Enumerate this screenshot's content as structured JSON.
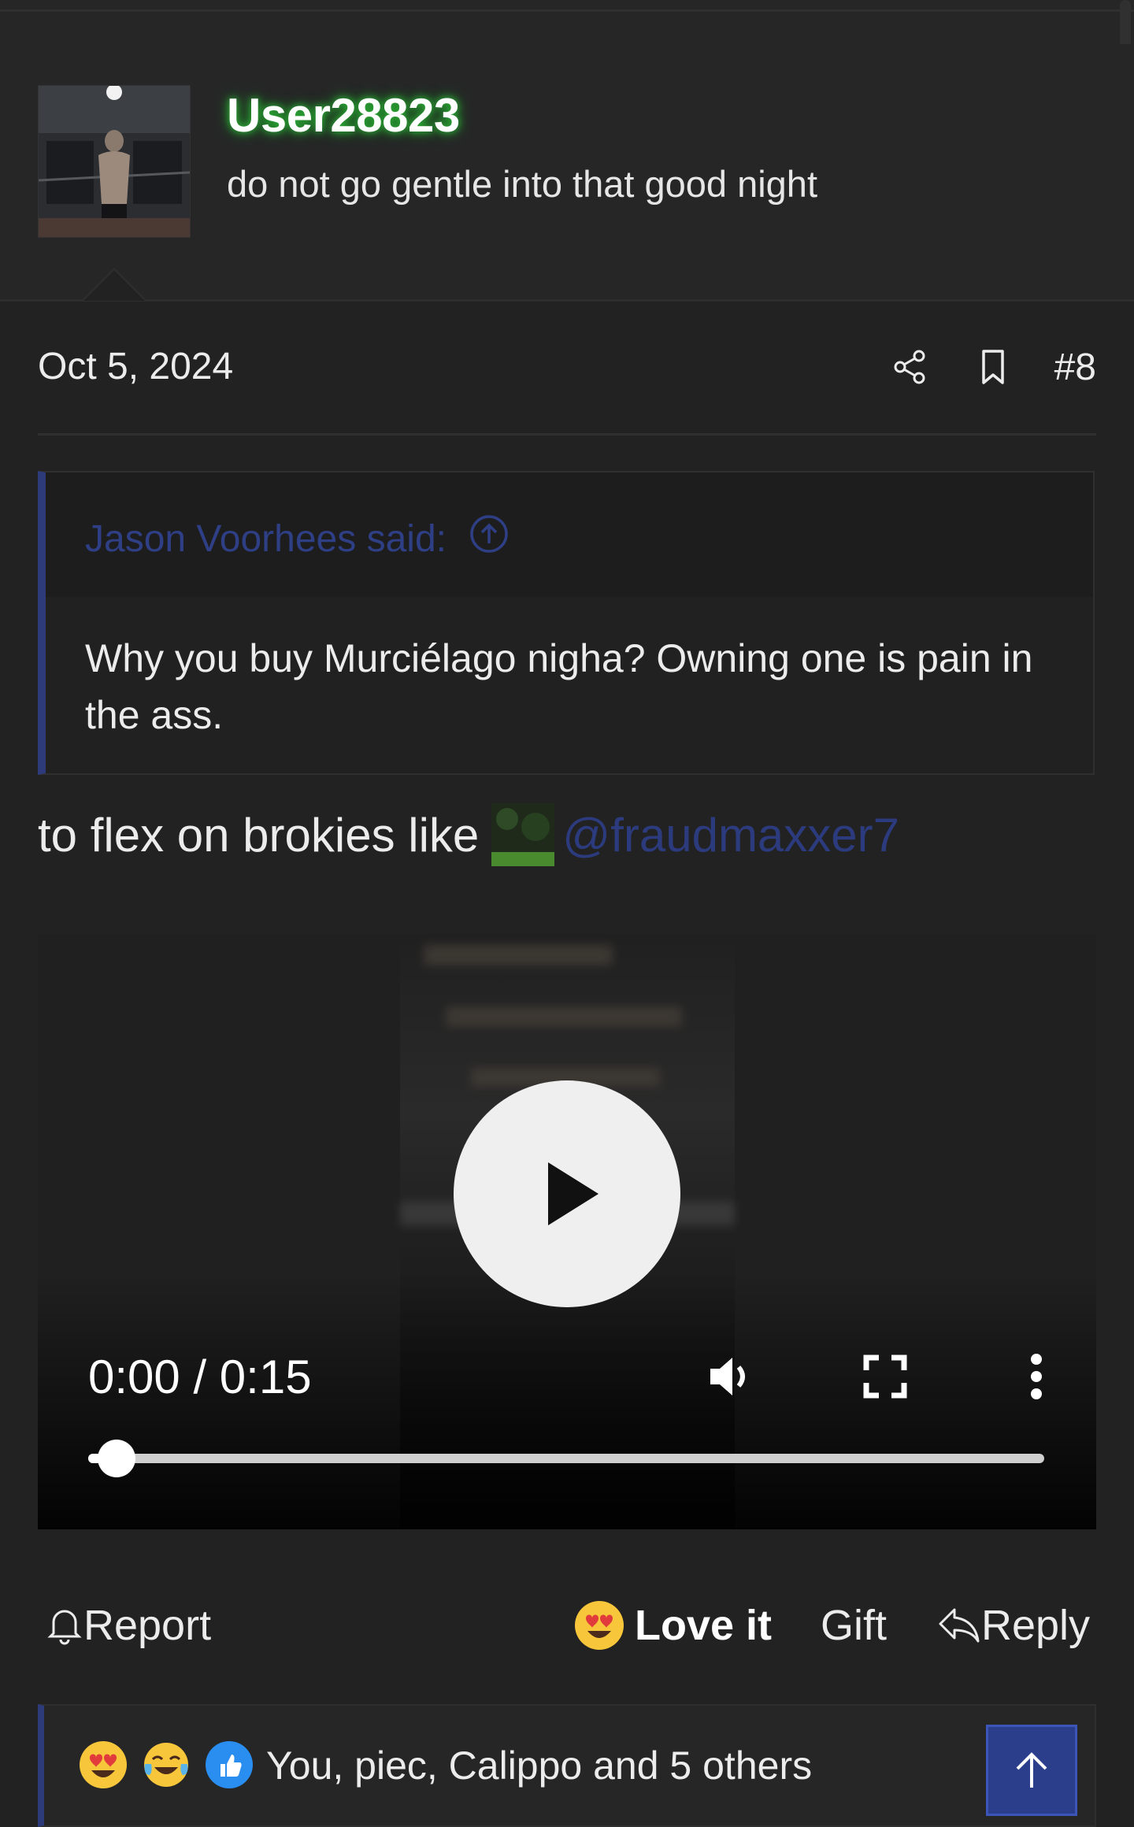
{
  "user": {
    "name": "User28823",
    "title": "do not go gentle into that good night"
  },
  "post": {
    "date": "Oct 5, 2024",
    "number": "#8"
  },
  "quote": {
    "author": "Jason Voorhees said:",
    "body": "Why you buy Murciélago nigha? Owning one is pain in the ass."
  },
  "reply": {
    "text": "to flex on brokies like",
    "mention": "@fraudmaxxer7"
  },
  "video": {
    "time": "0:00 / 0:15",
    "progress_percent": 3
  },
  "actions": {
    "report": "Report",
    "love": "Love it",
    "gift": "Gift",
    "reply": "Reply"
  },
  "reactions": {
    "summary": "You, piec, Calippo and 5 others",
    "icons": [
      "heart-eyes-emoji",
      "tears-of-joy-emoji",
      "thumbs-up-emoji"
    ]
  },
  "colors": {
    "background": "#222223",
    "accent": "#2d3b7a",
    "link": "#2f3f86",
    "username_glow": "#2fbf3a"
  }
}
